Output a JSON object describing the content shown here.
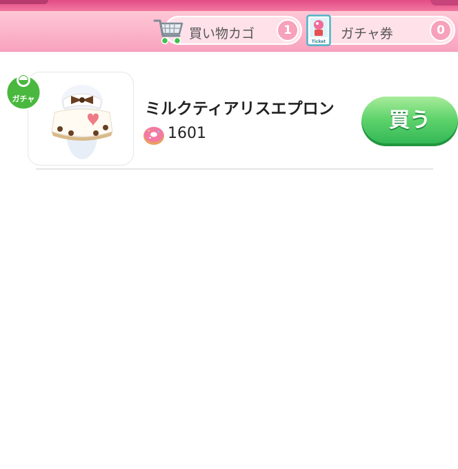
{
  "header": {
    "cart": {
      "label": "買い物カゴ",
      "count": "1",
      "icon": "shopping-cart-icon"
    },
    "ticket": {
      "label": "ガチャ券",
      "count": "0",
      "icon": "ticket-icon",
      "icon_text": "Ticket"
    }
  },
  "item": {
    "badge": "ガチャ",
    "name": "ミルクティアリスエプロン",
    "price_icon": "donut-icon",
    "price": "1601",
    "buy_label": "買う"
  },
  "colors": {
    "accent_pink": "#f26a9a",
    "buy_green": "#3cc25d",
    "badge_green": "#4ab83f"
  }
}
